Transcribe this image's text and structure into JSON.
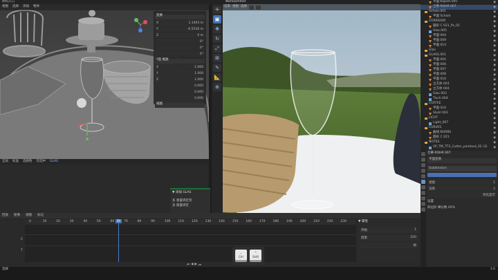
{
  "topbar": {
    "left_text": "吹料入口",
    "title": "Wohnzimmer"
  },
  "viewport": {
    "header_items": [
      "视图",
      "选择",
      "添加",
      "物体"
    ],
    "footer_items": [
      "全局",
      "标准",
      "选择性",
      "仅选中",
      "GLAS"
    ],
    "npanel": {
      "section1": "变换",
      "rows1": [
        [
          "X",
          "1.1493 m"
        ],
        [
          "Y",
          "-0.5536 m"
        ],
        [
          "Z",
          "0 m"
        ],
        [
          "",
          "0°"
        ],
        [
          "",
          "0°"
        ],
        [
          "",
          "0°"
        ]
      ],
      "section2": "Y型 缩放",
      "rows2": [
        [
          "X",
          "1.000"
        ],
        [
          "Y",
          "1.000"
        ],
        [
          "Z",
          "1.000"
        ],
        [
          "",
          "0.000"
        ],
        [
          "",
          "0.000"
        ],
        [
          "",
          "0.000"
        ]
      ],
      "section3": "视图"
    }
  },
  "operator_panel": {
    "title": "▼ 添加 GLAS",
    "line1": "多 重置绑定到",
    "line2": "多·重置绑定"
  },
  "tools": [
    "cursor",
    "select",
    "move",
    "rotate",
    "scale",
    "transform",
    "annotate",
    "measure",
    "add"
  ],
  "render_header": {
    "mode": "渲染",
    "items": [
      "视图",
      "选择"
    ]
  },
  "outliner": {
    "rows": [
      {
        "label": "平面 Kapsel.005",
        "type": "tri",
        "sel": false
      },
      {
        "label": "兰蒂 ROHR 007",
        "type": "tri",
        "sel": true
      },
      {
        "label": "Schale.001",
        "type": "fold",
        "sel": false
      },
      {
        "label": "平面 Schale",
        "type": "tri",
        "sel": false
      },
      {
        "label": "CORRIDOR",
        "type": "fold",
        "sel": false
      },
      {
        "label": "圆形 C 021_Ps_01",
        "type": "tri",
        "sel": false
      },
      {
        "label": "Glas.005",
        "type": "box",
        "sel": false
      },
      {
        "label": "平面 004",
        "type": "tri",
        "sel": false
      },
      {
        "label": "平面 009",
        "type": "tri",
        "sel": false
      },
      {
        "label": "平面 014",
        "type": "tri",
        "sel": false
      },
      {
        "label": "Glas",
        "type": "fold",
        "sel": false
      },
      {
        "label": "GLASS.001",
        "type": "fold",
        "sel": false
      },
      {
        "label": "平面 005",
        "type": "tri",
        "sel": false
      },
      {
        "label": "平面 006",
        "type": "tri",
        "sel": false
      },
      {
        "label": "平面 007",
        "type": "tri",
        "sel": false
      },
      {
        "label": "平面 008",
        "type": "tri",
        "sel": false
      },
      {
        "label": "平面 010",
        "type": "tri",
        "sel": false
      },
      {
        "label": "立方体 003",
        "type": "tri",
        "sel": false
      },
      {
        "label": "立方体 004",
        "type": "tri",
        "sel": false
      },
      {
        "label": "Glas 003",
        "type": "box",
        "sel": false
      },
      {
        "label": "Tisch.004",
        "type": "box",
        "sel": false
      },
      {
        "label": "COFFEE",
        "type": "fold",
        "sel": false
      },
      {
        "label": "平面 016",
        "type": "tri",
        "sel": false
      },
      {
        "label": "Stuhl 003",
        "type": "tri",
        "sel": false
      },
      {
        "label": "LICHT",
        "type": "fold",
        "sel": false
      },
      {
        "label": "Light_007",
        "type": "box",
        "sel": false
      },
      {
        "label": "CURVES",
        "type": "fold",
        "sel": false
      },
      {
        "label": "曲线 NURBS",
        "type": "tri",
        "sel": false
      },
      {
        "label": "圆形 C 021",
        "type": "tri",
        "sel": false
      },
      {
        "label": "NOTES",
        "type": "fold",
        "sel": false
      },
      {
        "label": "VP_TM_TT3_Cutter_pointout_02 (3)",
        "type": "box",
        "sel": false
      }
    ]
  },
  "properties": {
    "header": "兰蒂 ROHR 007",
    "section": "平面变换",
    "field_label": "Subdivision",
    "rows": [
      [
        "视窗",
        "1"
      ],
      [
        "渲染",
        "2"
      ],
      [
        "",
        "优化显示"
      ]
    ],
    "section2": "设置",
    "section3": "四边形 细分数 00%"
  },
  "timeline": {
    "header_items": [
      "回放",
      "抠像",
      "视图",
      "标记"
    ],
    "playhead_frame": "80",
    "ruler": [
      "0",
      "10",
      "20",
      "30",
      "40",
      "50",
      "60",
      "70",
      "80",
      "90",
      "100",
      "110",
      "120",
      "130",
      "140",
      "150",
      "160",
      "170",
      "180",
      "190",
      "200",
      "210",
      "220",
      "230"
    ],
    "channels": [
      "S",
      "C",
      "T"
    ],
    "right_panel_title": "▼ 属性",
    "right_rows": [
      [
        "开始",
        "1"
      ],
      [
        "结束",
        "250"
      ],
      [
        "",
        "帧"
      ]
    ]
  },
  "keys": [
    {
      "top": "⌄",
      "bottom": "Ctrl"
    },
    {
      "top": "^",
      "bottom": "Shift"
    }
  ],
  "status": {
    "left": "选择",
    "right": "3.6"
  }
}
